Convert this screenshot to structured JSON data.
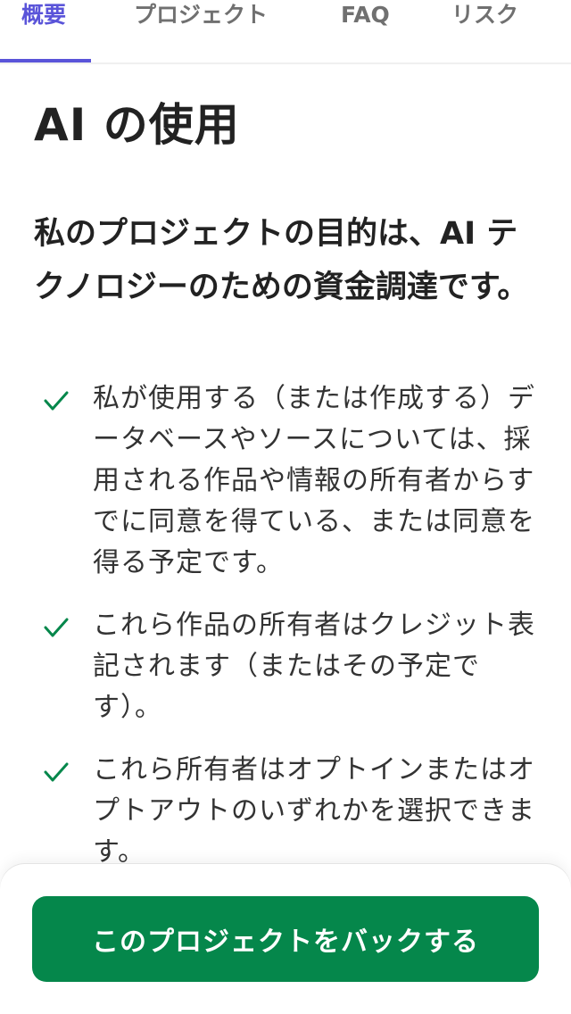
{
  "tabs": {
    "overview": "概要",
    "project": "プロジェクト",
    "faq": "FAQ",
    "risk": "リスク"
  },
  "section": {
    "title": "AI の使用",
    "lead": "私のプロジェクトの目的は、AI テクノロジーのための資金調達です。",
    "items": [
      "私が使用する（または作成する）データベースやソースについては、採用される作品や情報の所有者からすでに同意を得ている、または同意を得る予定です。",
      "これら作品の所有者はクレジット表記されます（またはその予定です）。",
      "これら所有者はオプトインまたはオプトアウトのいずれかを選択できます。"
    ]
  },
  "cta": {
    "label": "このプロジェクトをバックする"
  },
  "colors": {
    "accent": "#5a54d9",
    "primary_green": "#05874b",
    "check_green": "#05874b"
  },
  "icons": {
    "check": "check-icon"
  }
}
